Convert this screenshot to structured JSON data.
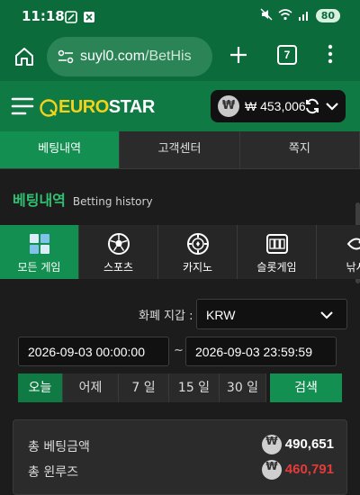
{
  "status": {
    "time": "11:18",
    "battery": "80"
  },
  "browser": {
    "url_main": "suyl0.com",
    "url_rest": "/BetHis",
    "tab_count": "7"
  },
  "site": {
    "logo_part1": "EURO",
    "logo_part2": "STAR",
    "currency_symbol": "₩",
    "balance": "₩ 453,006"
  },
  "top_tabs": [
    "베팅내역",
    "고객센터",
    "쪽지"
  ],
  "page": {
    "title_ko": "베팅내역",
    "title_en": "Betting history"
  },
  "categories": [
    {
      "label": "모든 게임",
      "icon": "grid-icon"
    },
    {
      "label": "스포츠",
      "icon": "soccer-ball-icon"
    },
    {
      "label": "카지노",
      "icon": "casino-chip-icon"
    },
    {
      "label": "슬롯게임",
      "icon": "slot-machine-icon"
    },
    {
      "label": "낚시",
      "icon": "fish-icon"
    }
  ],
  "filter": {
    "currency_label": "화폐 지갑 :",
    "currency_value": "KRW",
    "date_from": "2026-09-03 00:00:00",
    "date_to": "2026-09-03 23:59:59",
    "tilde": "~"
  },
  "range": [
    "오늘",
    "어제",
    "7 일",
    "15 일",
    "30 일"
  ],
  "search_label": "검색",
  "summary": {
    "bet_label": "총 베팅금액",
    "bet_value": "490,651",
    "winloss_label": "총 윈루즈",
    "winloss_value": "460,791"
  },
  "colors": {
    "brand_green": "#139051",
    "header_green": "#0c6b3b",
    "loss_red": "#e53a3a",
    "logo_yellow": "#f2d21a"
  }
}
